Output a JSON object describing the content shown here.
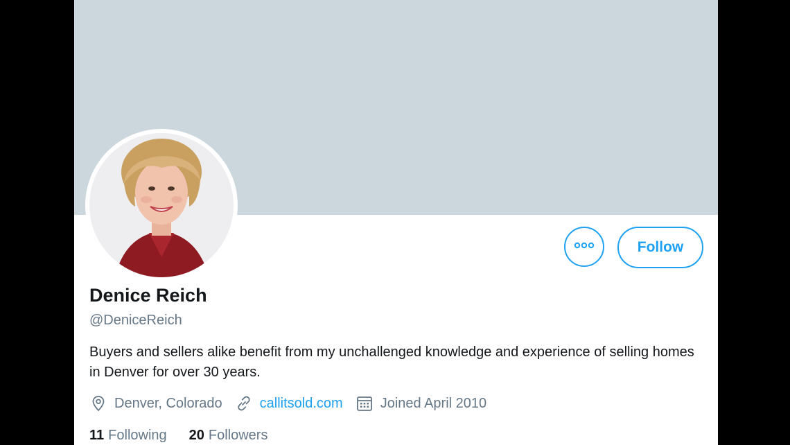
{
  "colors": {
    "banner": "#ccd6dd",
    "accent": "#1da1f2",
    "text_primary": "#14171a",
    "text_secondary": "#657786",
    "outer_background": "#000000"
  },
  "profile": {
    "name": "Denice Reich",
    "handle": "@DeniceReich",
    "bio": "Buyers and sellers alike benefit from my unchallenged knowledge and experience of selling homes in Denver for over 30 years.",
    "location": "Denver, Colorado",
    "website": "callitsold.com",
    "joined": "Joined April 2010",
    "avatar_icon": "profile-photo"
  },
  "actions": {
    "more_icon": "more-dots-icon",
    "follow_label": "Follow"
  },
  "stats": {
    "following_count": "11",
    "following_label": "Following",
    "followers_count": "20",
    "followers_label": "Followers"
  },
  "icons": {
    "location": "location-pin-icon",
    "link": "link-icon",
    "calendar": "calendar-icon"
  }
}
